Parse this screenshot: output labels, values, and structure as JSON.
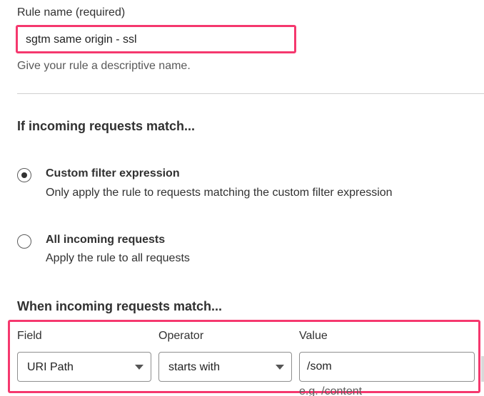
{
  "rule_name": {
    "label": "Rule name (required)",
    "value": "sgtm same origin - ssl",
    "help": "Give your rule a descriptive name.",
    "highlight_color": "#f5386e"
  },
  "incoming": {
    "heading": "If incoming requests match...",
    "options": [
      {
        "title": "Custom filter expression",
        "description": "Only apply the rule to requests matching the custom filter expression",
        "selected": true
      },
      {
        "title": "All incoming requests",
        "description": "Apply the rule to all requests",
        "selected": false
      }
    ]
  },
  "when_match": {
    "heading": "When incoming requests match...",
    "field_label": "Field",
    "operator_label": "Operator",
    "value_label": "Value",
    "field_value": "URI Path",
    "operator_value": "starts with",
    "value_value": "/som",
    "value_hint": "e.g. /content",
    "highlight_color": "#f5386e"
  }
}
